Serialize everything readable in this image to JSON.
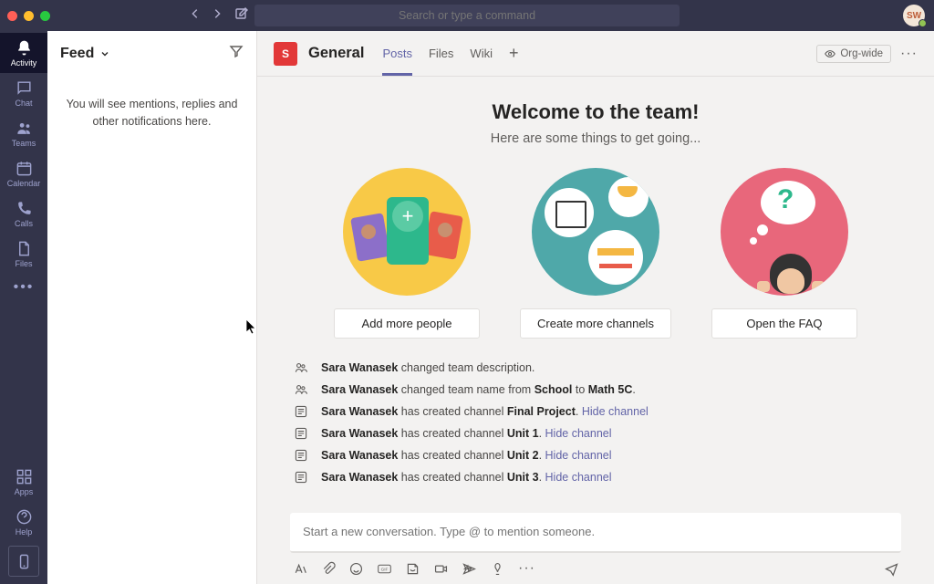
{
  "search": {
    "placeholder": "Search or type a command"
  },
  "avatar": {
    "initials": "SW"
  },
  "rail": {
    "items": [
      "Activity",
      "Chat",
      "Teams",
      "Calendar",
      "Calls",
      "Files"
    ],
    "bottom": [
      "Apps",
      "Help"
    ]
  },
  "feed": {
    "title": "Feed",
    "empty": "You will see mentions, replies and other notifications here."
  },
  "channel": {
    "team_initial": "S",
    "name": "General",
    "tabs": [
      "Posts",
      "Files",
      "Wiki"
    ],
    "badge": "Org-wide"
  },
  "welcome": {
    "title": "Welcome to the team!",
    "subtitle": "Here are some things to get going...",
    "cards": [
      "Add more people",
      "Create more channels",
      "Open the FAQ"
    ]
  },
  "log": [
    {
      "icon": "team",
      "actor": "Sara Wanasek",
      "rest": " changed team description."
    },
    {
      "icon": "team",
      "actor": "Sara Wanasek",
      "rest_pre": " changed team name from ",
      "b1": "School",
      "mid": " to ",
      "b2": "Math 5C",
      "suf": "."
    },
    {
      "icon": "channel",
      "actor": "Sara Wanasek",
      "rest_pre": " has created channel ",
      "b1": "Final Project",
      "suf": ". ",
      "link": "Hide channel"
    },
    {
      "icon": "channel",
      "actor": "Sara Wanasek",
      "rest_pre": " has created channel ",
      "b1": "Unit 1",
      "suf": ". ",
      "link": "Hide channel"
    },
    {
      "icon": "channel",
      "actor": "Sara Wanasek",
      "rest_pre": " has created channel ",
      "b1": "Unit 2",
      "suf": ". ",
      "link": "Hide channel"
    },
    {
      "icon": "channel",
      "actor": "Sara Wanasek",
      "rest_pre": " has created channel ",
      "b1": "Unit 3",
      "suf": ". ",
      "link": "Hide channel"
    }
  ],
  "composer": {
    "placeholder": "Start a new conversation. Type @ to mention someone."
  }
}
